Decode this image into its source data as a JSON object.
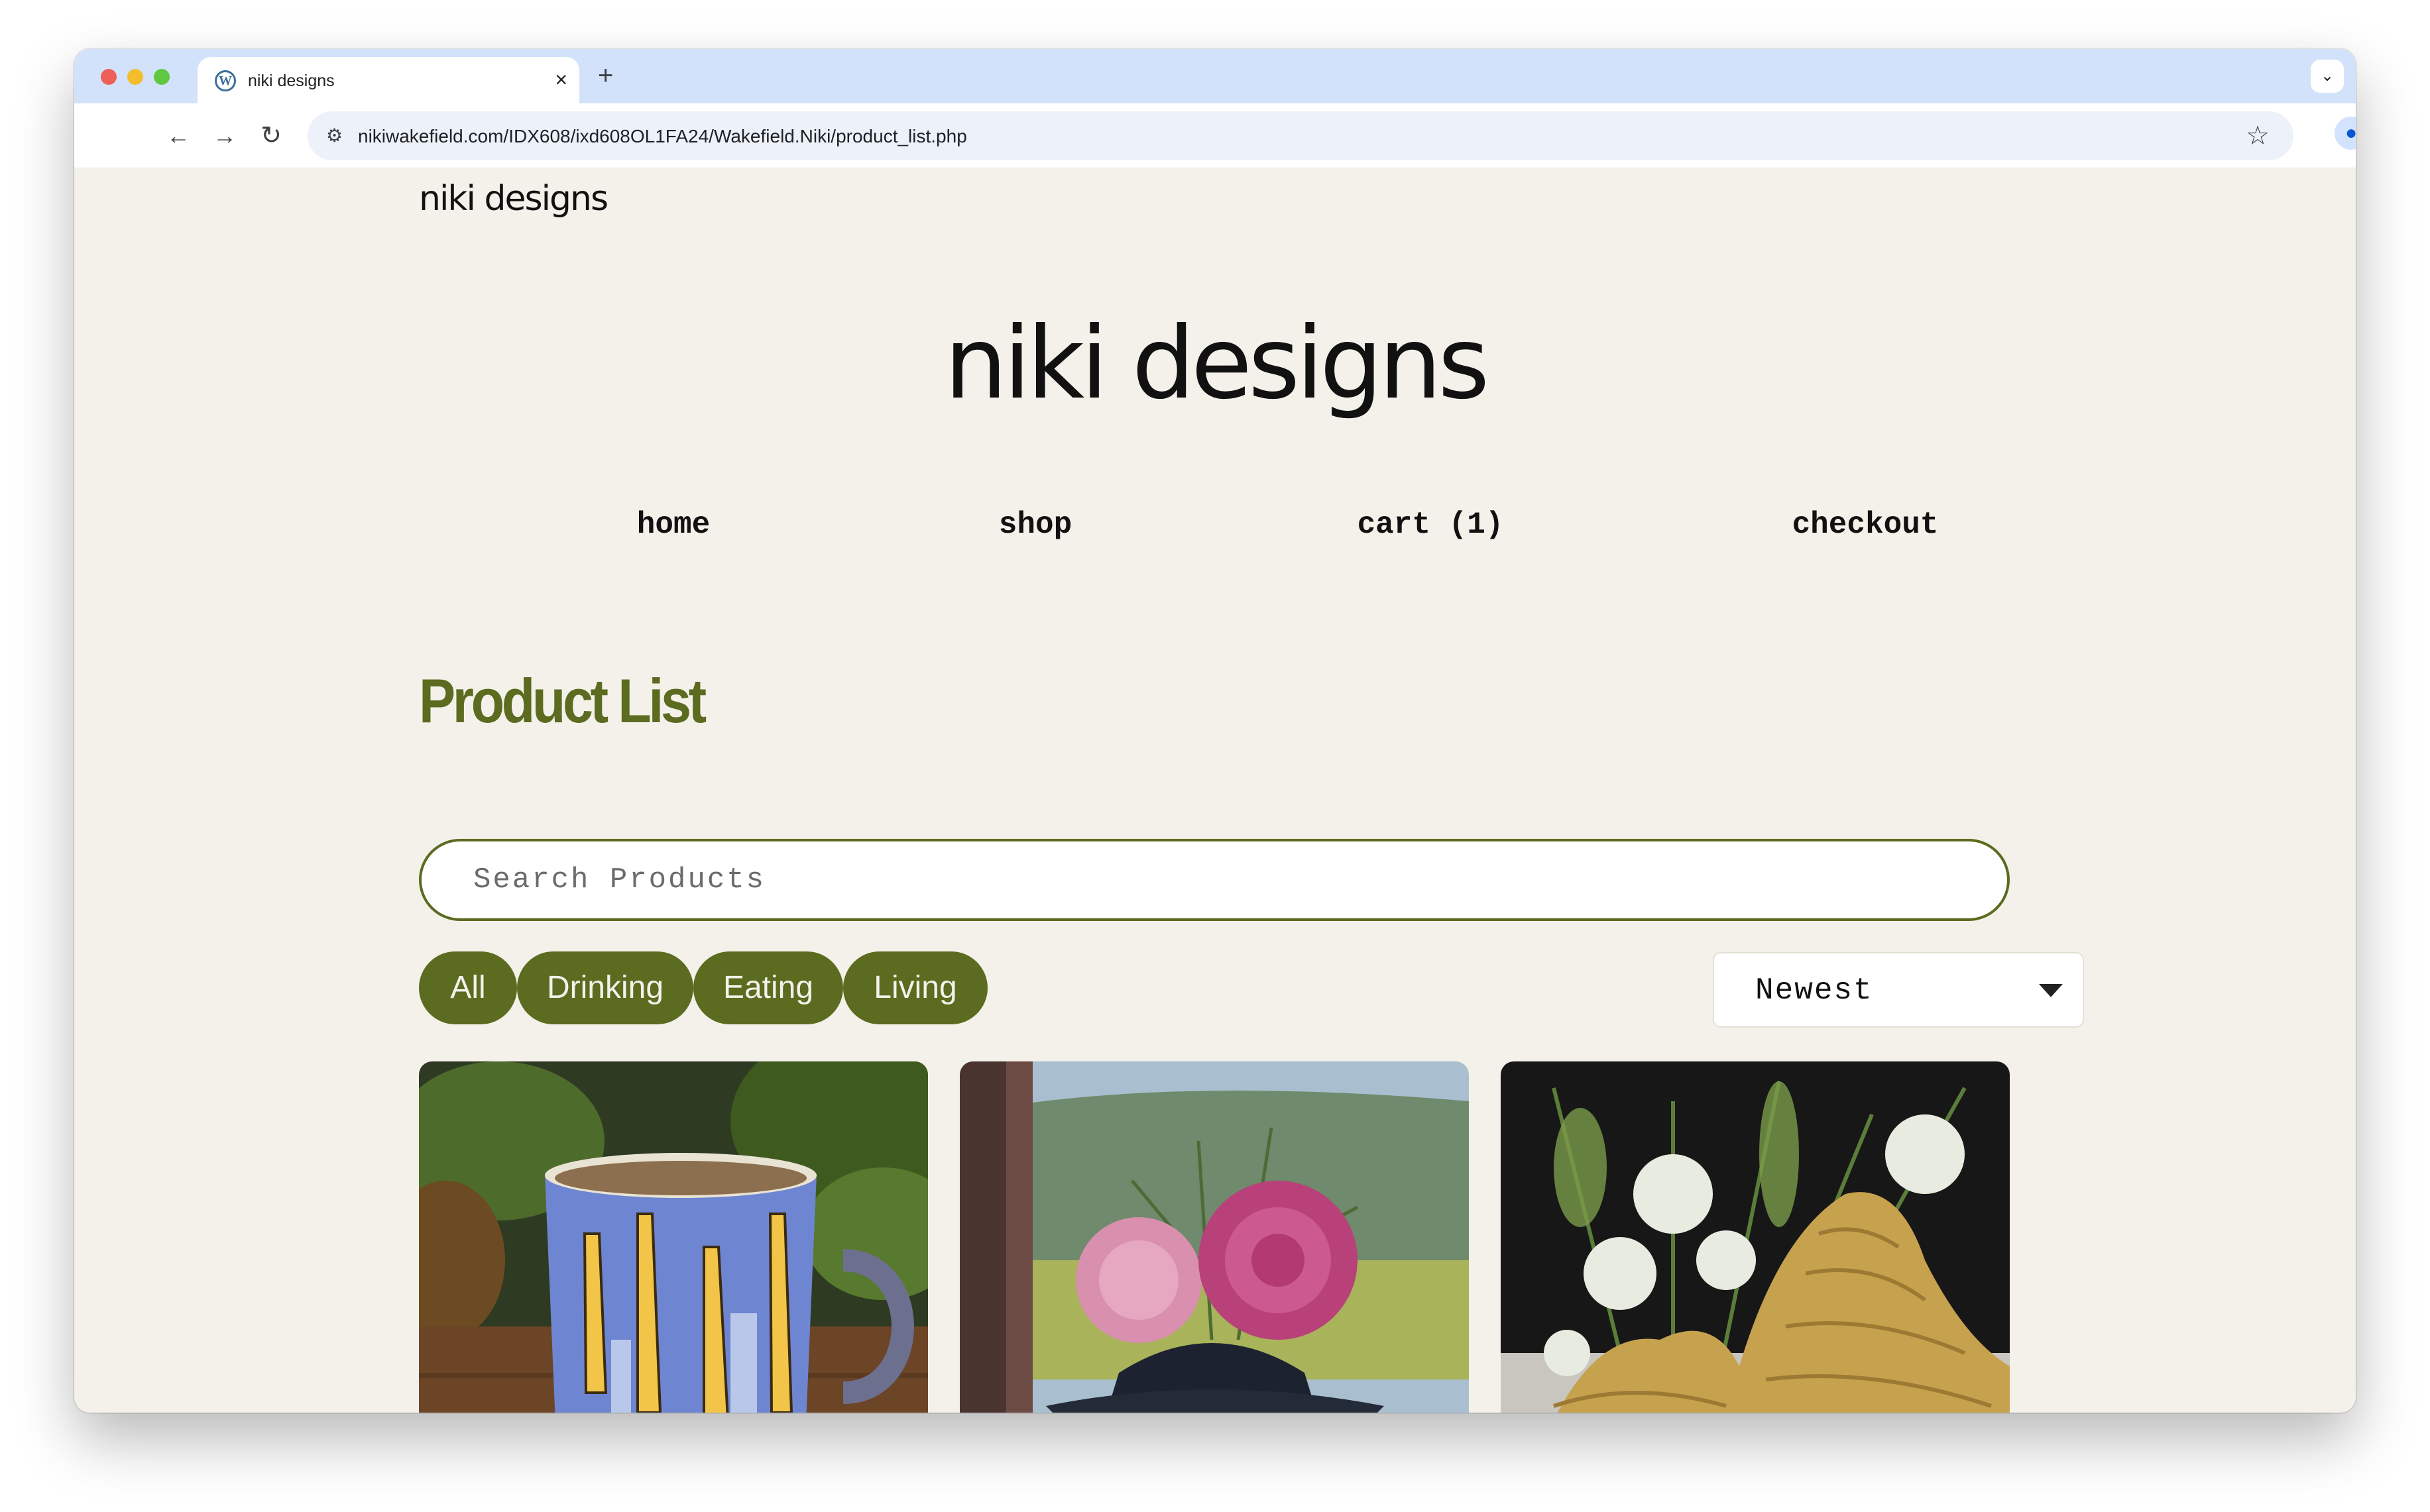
{
  "browser": {
    "tab_title": "niki designs",
    "tab_icon": "wordpress-icon",
    "url": "nikiwakefield.com/IDX608/ixd608OL1FA24/Wakefield.Niki/product_list.php"
  },
  "site": {
    "small_logo": "niki designs",
    "big_logo": "niki designs"
  },
  "nav": {
    "home": "home",
    "shop": "shop",
    "cart": "cart (1)",
    "checkout": "checkout"
  },
  "main": {
    "title": "Product List",
    "search_placeholder": "Search Products",
    "filters": {
      "all": "All",
      "drinking": "Drinking",
      "eating": "Eating",
      "living": "Living"
    },
    "sort": {
      "selected": "Newest"
    }
  },
  "products": [
    {
      "image": "blue mug with giraffes"
    },
    {
      "image": "black vase with pink peonies"
    },
    {
      "image": "gold textured vase with wildflowers"
    }
  ],
  "colors": {
    "accent": "#5b6b1f",
    "page_bg": "#f3f1ea",
    "tabstrip_bg": "#d3e2fb"
  }
}
